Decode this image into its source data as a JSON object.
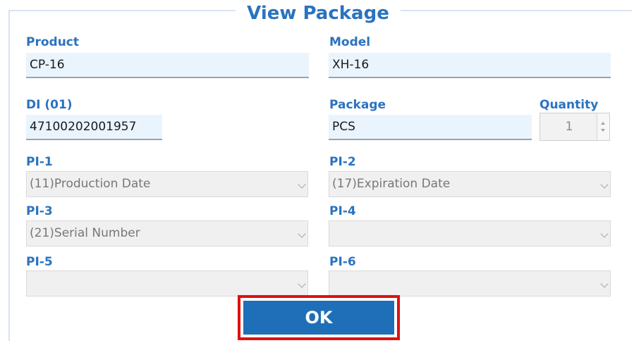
{
  "dialog": {
    "title": "View Package"
  },
  "fields": {
    "product": {
      "label": "Product",
      "value": "CP-16"
    },
    "model": {
      "label": "Model",
      "value": "XH-16"
    },
    "di": {
      "label": "DI (01)",
      "value": "47100202001957"
    },
    "package": {
      "label": "Package",
      "value": "PCS"
    },
    "quantity": {
      "label": "Quantity",
      "value": "1"
    }
  },
  "pi": {
    "pi1": {
      "label": "PI-1",
      "value": "(11)Production Date"
    },
    "pi2": {
      "label": "PI-2",
      "value": "(17)Expiration Date"
    },
    "pi3": {
      "label": "PI-3",
      "value": "(21)Serial Number"
    },
    "pi4": {
      "label": "PI-4",
      "value": ""
    },
    "pi5": {
      "label": "PI-5",
      "value": ""
    },
    "pi6": {
      "label": "PI-6",
      "value": ""
    }
  },
  "actions": {
    "ok_label": "OK"
  },
  "colors": {
    "accent": "#2a73bf",
    "button": "#1f6fb8",
    "highlight": "#e01010",
    "field_bg": "#eaf4fd"
  }
}
